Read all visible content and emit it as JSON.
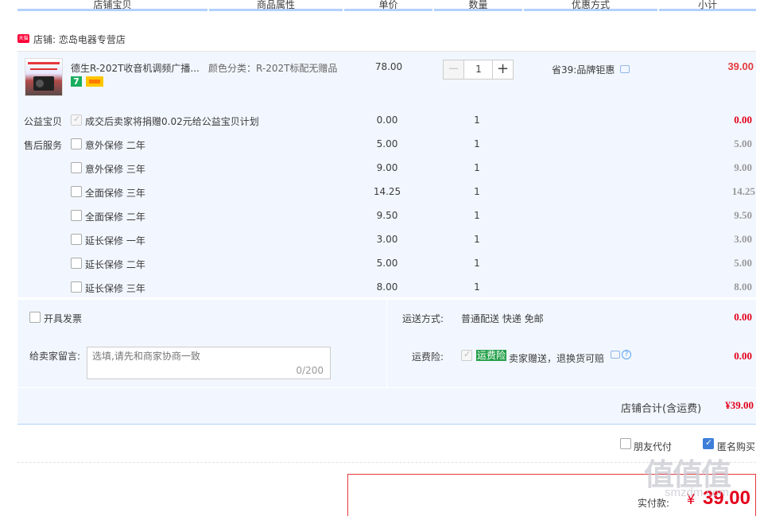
{
  "header": {
    "columns": [
      "店铺宝贝",
      "商品属性",
      "单价",
      "数量",
      "优惠方式",
      "小计"
    ]
  },
  "store": {
    "icon_text": "天猫",
    "label": "店铺: 恋岛电器专营店"
  },
  "item": {
    "title": "德生R-202T收音机调频广播...",
    "attr_label": "颜色分类：",
    "attr_value": "R-202T标配无赠品",
    "price": "78.00",
    "quantity": "1",
    "minus": "−",
    "plus": "+",
    "promo": "省39:品牌钜惠",
    "subtotal": "39.00",
    "badge": "7"
  },
  "charity": {
    "label": "公益宝贝",
    "text": "成交后卖家将捐赠0.02元给公益宝贝计划",
    "price": "0.00",
    "qty": "1",
    "subtotal": "0.00"
  },
  "services": {
    "label": "售后服务",
    "items": [
      {
        "name": "意外保修 二年",
        "price": "5.00",
        "qty": "1",
        "subtotal": "5.00"
      },
      {
        "name": "意外保修 三年",
        "price": "9.00",
        "qty": "1",
        "subtotal": "9.00"
      },
      {
        "name": "全面保修 三年",
        "price": "14.25",
        "qty": "1",
        "subtotal": "14.25"
      },
      {
        "name": "全面保修 二年",
        "price": "9.50",
        "qty": "1",
        "subtotal": "9.50"
      },
      {
        "name": "延长保修 一年",
        "price": "3.00",
        "qty": "1",
        "subtotal": "3.00"
      },
      {
        "name": "延长保修 二年",
        "price": "5.00",
        "qty": "1",
        "subtotal": "5.00"
      },
      {
        "name": "延长保修 三年",
        "price": "8.00",
        "qty": "1",
        "subtotal": "8.00"
      }
    ]
  },
  "invoice": {
    "label": "开具发票"
  },
  "shipping": {
    "label": "运送方式:",
    "value": "普通配送 快递 免邮",
    "fee": "0.00"
  },
  "message": {
    "label": "给卖家留言:",
    "placeholder": "选填,请先和商家协商一致",
    "count": "0/200"
  },
  "insurance": {
    "label": "运费险:",
    "tag": "运费险",
    "text": "卖家赠送，退换货可赔",
    "help": "?",
    "fee": "0.00"
  },
  "store_total": {
    "label": "店铺合计(含运费)",
    "value": "¥39.00"
  },
  "options": {
    "friend_pay": "朋友代付",
    "anonymous": "匿名购买"
  },
  "final": {
    "label": "实付款:",
    "yen": "¥",
    "value": "39.00"
  },
  "watermark": {
    "text": "值值值",
    "sub": "smzdm.com"
  },
  "colors": {
    "accent_red": "#e4001b",
    "header_underline": "#b2d1ff",
    "panel_bg": "#f2f7ff",
    "insurance_green": "#24a04a",
    "check_blue": "#3d7ed8"
  }
}
